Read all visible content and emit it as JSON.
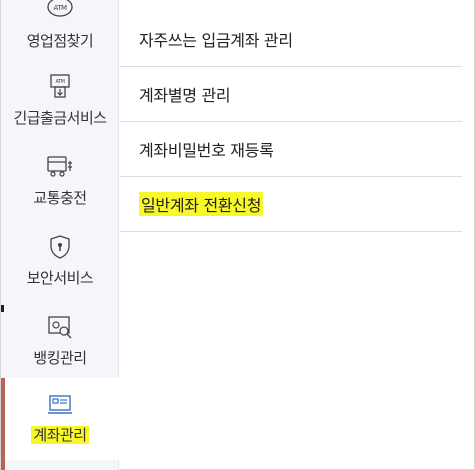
{
  "sidebar": {
    "items": [
      {
        "label": "영업점찾기",
        "icon": "atm-location-icon"
      },
      {
        "label": "긴급출금서비스",
        "icon": "atm-withdraw-icon"
      },
      {
        "label": "교통충전",
        "icon": "transit-card-icon"
      },
      {
        "label": "보안서비스",
        "icon": "shield-icon"
      },
      {
        "label": "뱅킹관리",
        "icon": "banking-settings-icon"
      },
      {
        "label": "계좌관리",
        "icon": "account-card-icon"
      }
    ],
    "icon_badge": "ATM",
    "active_index": 5,
    "active_color": "#b76455",
    "highlight_color": "#f7f72a"
  },
  "menu": {
    "items": [
      {
        "label": "자주쓰는 입금계좌 관리"
      },
      {
        "label": "계좌별명 관리"
      },
      {
        "label": "계좌비밀번호 재등록"
      },
      {
        "label": "일반계좌 전환신청",
        "highlighted": true
      }
    ]
  }
}
